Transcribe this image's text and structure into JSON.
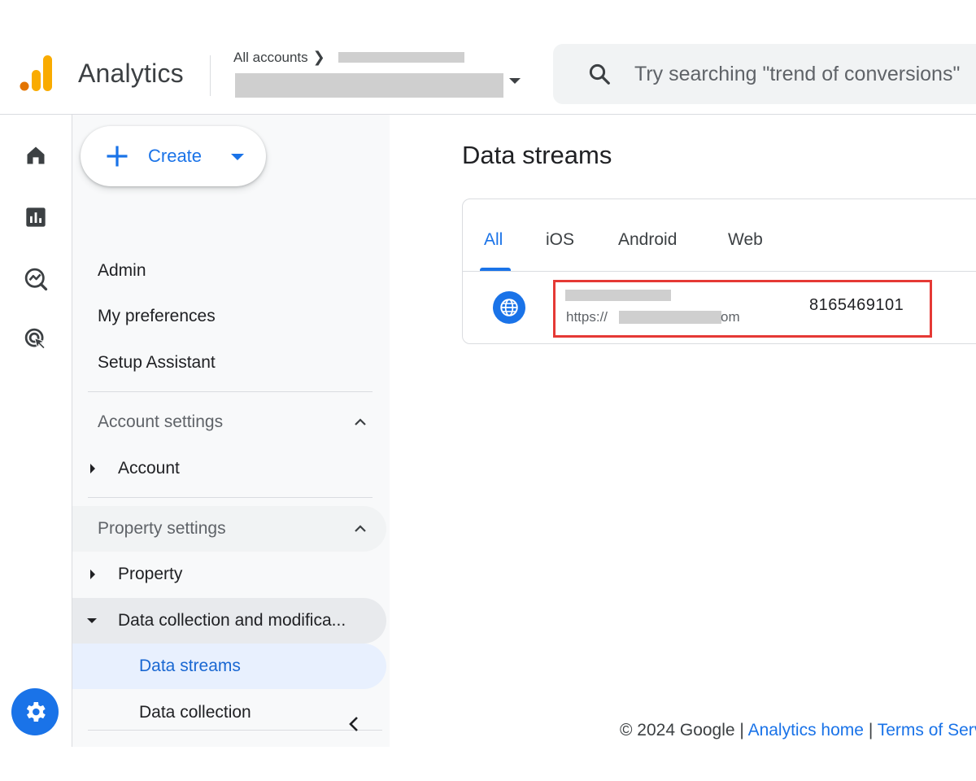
{
  "header": {
    "app_title": "Analytics",
    "breadcrumb": "All accounts",
    "search_placeholder": "Try searching \"trend of conversions\""
  },
  "rail": {
    "items": [
      {
        "icon": "home-icon"
      },
      {
        "icon": "reports-icon"
      },
      {
        "icon": "explore-icon"
      },
      {
        "icon": "advertising-icon"
      }
    ],
    "settings_icon": "gear-icon"
  },
  "sidebar": {
    "create_label": "Create",
    "items": [
      "Admin",
      "My preferences",
      "Setup Assistant"
    ],
    "account_settings": {
      "title": "Account settings",
      "items": [
        "Account"
      ]
    },
    "property_settings": {
      "title": "Property settings",
      "items": [
        "Property",
        "Data collection and modifica..."
      ],
      "subitems": [
        "Data streams",
        "Data collection"
      ]
    }
  },
  "main": {
    "title": "Data streams",
    "tabs": [
      "All",
      "iOS",
      "Android",
      "Web"
    ],
    "active_tab": "All",
    "stream": {
      "url_prefix": "https://",
      "url_suffix": "om",
      "id": "8165469101"
    }
  },
  "footer": {
    "copyright": "© 2024 Google |",
    "link_home": "Analytics home",
    "separator": "|",
    "link_terms": "Terms of Service"
  },
  "colors": {
    "accent": "#1a73e8",
    "highlight": "#e53935",
    "logo_orange": "#f9ab00",
    "logo_dark": "#e37400"
  }
}
